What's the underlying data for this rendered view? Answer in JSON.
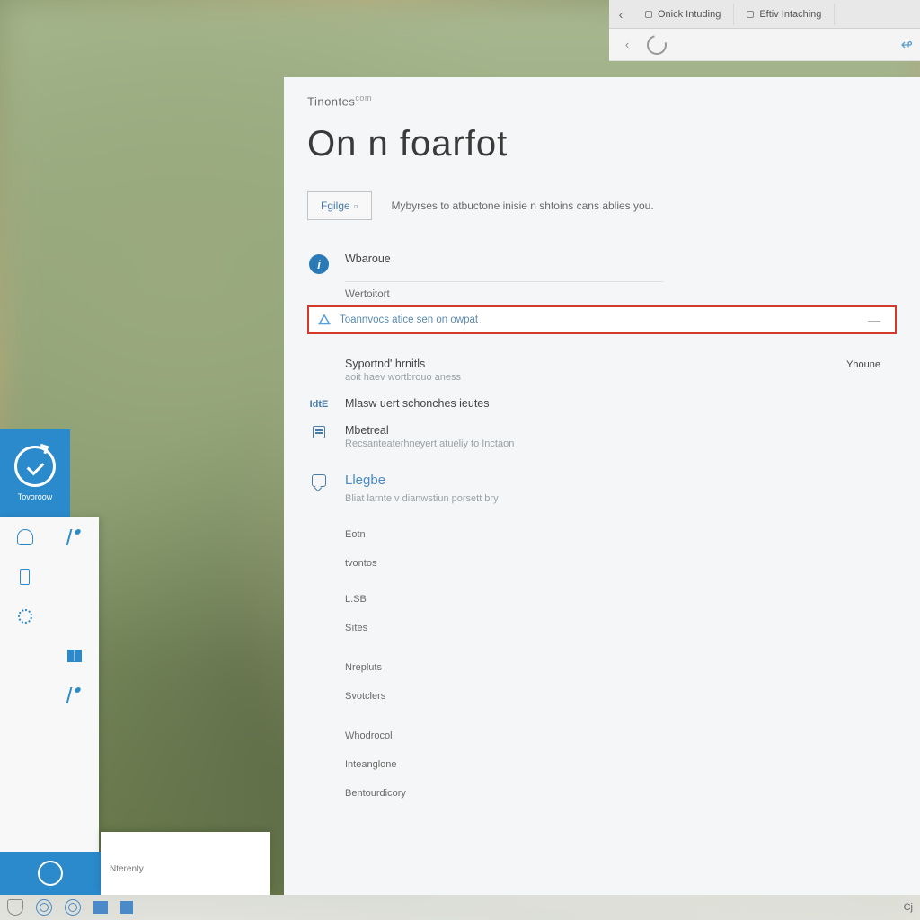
{
  "browser": {
    "tabs": [
      {
        "label": "Onick Intuding"
      },
      {
        "label": "Eftiv Intaching"
      }
    ]
  },
  "settings": {
    "breadcrumb": "Tinontes",
    "breadcrumb_suffix": "com",
    "title": "On n foarfot",
    "refine_button": "Fgilge",
    "refine_desc": "Mybyrses to atbuctone inisie n shtoins cans ablies you.",
    "item_account": {
      "title": "Wbaroue"
    },
    "sub_label": "Wertoitort",
    "highlighted": {
      "text": "Toannvocs atice sen on owpat"
    },
    "rows": [
      {
        "title": "Syportnd' hrnitls",
        "sub": "aoit haev wortbrouo aness",
        "right": "Yhoune"
      },
      {
        "icon_label": "IdtE",
        "title": "Mlasw uert schonches ieutes"
      },
      {
        "title": "Mbetreal",
        "sub": "Recsanteaterhneyert atueliy to Inctaon"
      }
    ],
    "blue_header": "Llegbe",
    "blue_sub": "Bliat larnte v dianwstiun porsett bry",
    "plain_items": [
      "Eotn",
      "tvontos",
      "L.SB",
      "Sıtes",
      "Nrepluts",
      "Svotclers",
      "Whodrocol",
      "Inteanglone",
      "Bentourdicory"
    ]
  },
  "tile": {
    "label": "Tovoroow"
  },
  "dock": {
    "label": "Nterenty"
  },
  "taskbar": {
    "clock_glyph": "Cj"
  }
}
